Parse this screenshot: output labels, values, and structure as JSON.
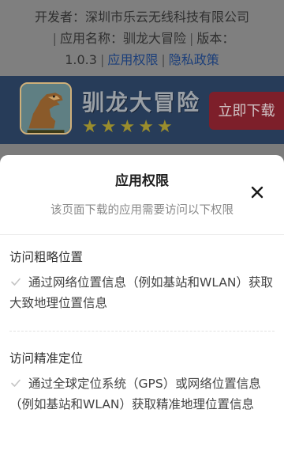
{
  "developer_info": {
    "developer_label": "开发者：",
    "developer_name": "深圳市乐云无线科技有限公司",
    "app_name_label": "应用名称：",
    "app_name": "驯龙大冒险",
    "version_label": "版本：",
    "version": "1.0.3",
    "permissions_link": "应用权限",
    "privacy_link": "隐私政策",
    "separator": "|"
  },
  "banner": {
    "title": "驯龙大冒险",
    "rating_stars": 5,
    "download_label": "立即下载",
    "icon": "dinosaur-app-icon",
    "star_icon": "star-icon"
  },
  "permissions_sheet": {
    "title": "应用权限",
    "subtitle": "该页面下载的应用需要访问以下权限",
    "close_icon": "close-icon",
    "check_icon": "check-icon",
    "items": [
      {
        "title": "访问粗略位置",
        "description": "通过网络位置信息（例如基站和WLAN）获取大致地理位置信息"
      },
      {
        "title": "访问精准定位",
        "description": "通过全球定位系统（GPS）或网络位置信息（例如基站和WLAN）获取精准地理位置信息"
      }
    ]
  },
  "colors": {
    "overlay_gray": "#7b7b7b",
    "banner_bg": "#273c59",
    "download_button": "#7d1f2a",
    "link_blue": "#1c3f7a",
    "star_gold": "#9a8d2d"
  }
}
